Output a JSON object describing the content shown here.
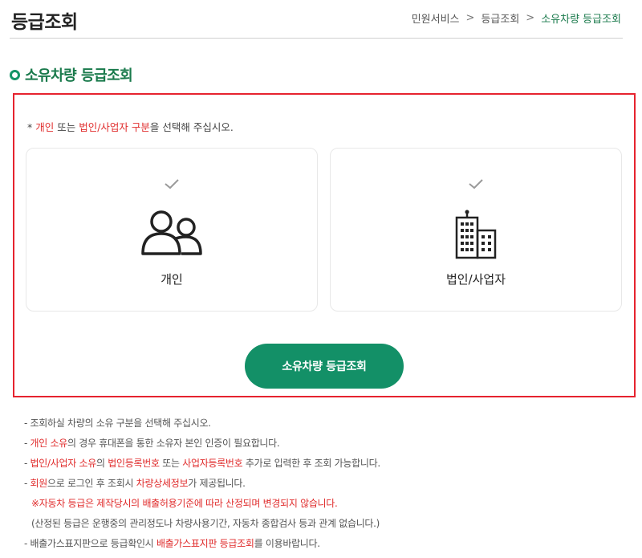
{
  "header": {
    "title": "등급조회",
    "breadcrumb": [
      "민원서비스",
      "등급조회",
      "소유차량 등급조회"
    ],
    "separator": ">"
  },
  "section": {
    "title": "소유차량 등급조회"
  },
  "instruction": {
    "prefix": "* ",
    "red1": "개인",
    "mid1": " 또는 ",
    "red2": "법인/사업자 구분",
    "suffix": "을 선택해 주십시오."
  },
  "cards": [
    {
      "label": "개인",
      "icon": "people-icon"
    },
    {
      "label": "법인/사업자",
      "icon": "building-icon"
    }
  ],
  "button": {
    "label": "소유차량 등급조회"
  },
  "notes": {
    "n1": "- 조회하실 차량의 소유 구분을 선택해 주십시오.",
    "n2": {
      "pre": "- ",
      "red": "개인 소유",
      "post": "의 경우 휴대폰을 통한 소유자 본인 인증이 필요합니다."
    },
    "n3": {
      "pre": "- ",
      "red1": "법인/사업자 소유",
      "mid1": "의 ",
      "red2": "법인등록번호",
      "mid2": " 또는 ",
      "red3": "사업자등록번호",
      "post": " 추가로 입력한 후 조회 가능합니다."
    },
    "n4": {
      "pre": "- ",
      "red1": "회원",
      "mid1": "으로 로그인 후 조회시 ",
      "red2": "차량상세정보",
      "post": "가 제공됩니다."
    },
    "n5": "※자동차 등급은 제작당시의 배출허용기준에 따라 산정되며 변경되지 않습니다.",
    "n6": "(산정된 등급은 운행중의 관리정도나 차량사용기간, 자동차 종합검사 등과 관계 없습니다.)",
    "n7": {
      "pre": "- 배출가스표지판으로 등급확인시 ",
      "red": "배출가스표지판 등급조회",
      "post": "를 이용바랍니다."
    }
  },
  "colors": {
    "accent": "#139067",
    "title_green": "#1a7a4c",
    "alert_red": "#e02d2d",
    "frame_red": "#e6232f"
  }
}
